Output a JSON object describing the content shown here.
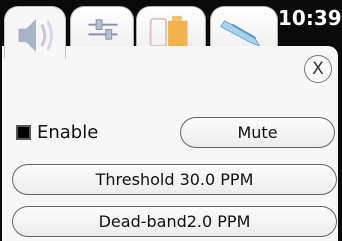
{
  "status_bar": {
    "time": "10:39"
  },
  "tabs": [
    {
      "icon": "speaker-icon",
      "active": true
    },
    {
      "icon": "sliders-icon",
      "active": false
    },
    {
      "icon": "battery-icon",
      "active": false
    },
    {
      "icon": "sensor-probe-icon",
      "active": false
    }
  ],
  "panel": {
    "close_label": "X",
    "enable": {
      "label": "Enable",
      "checked": true
    },
    "mute_label": "Mute",
    "threshold_label": "Threshold 30.0 PPM",
    "deadband_label": "Dead-band2.0 PPM"
  }
}
